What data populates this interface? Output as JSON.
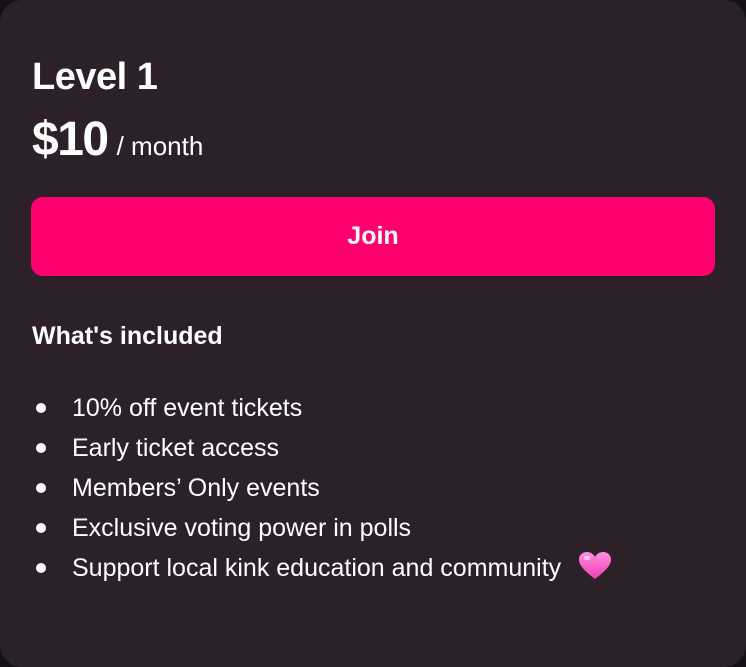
{
  "tier": {
    "name": "Level 1",
    "price": "$10",
    "period": "/ month"
  },
  "actions": {
    "join_label": "Join"
  },
  "included": {
    "heading": "What's included",
    "items": [
      {
        "label": "10% off event tickets"
      },
      {
        "label": "Early ticket access"
      },
      {
        "label": "Members’ Only events"
      },
      {
        "label": "Exclusive voting power in polls"
      },
      {
        "label": "Support local kink education and community",
        "icon": "pink-heart-icon"
      }
    ]
  },
  "colors": {
    "card_background": "#2d2129",
    "accent": "#ff006e",
    "text": "#ffffff",
    "heart": "#ff5fc8"
  }
}
